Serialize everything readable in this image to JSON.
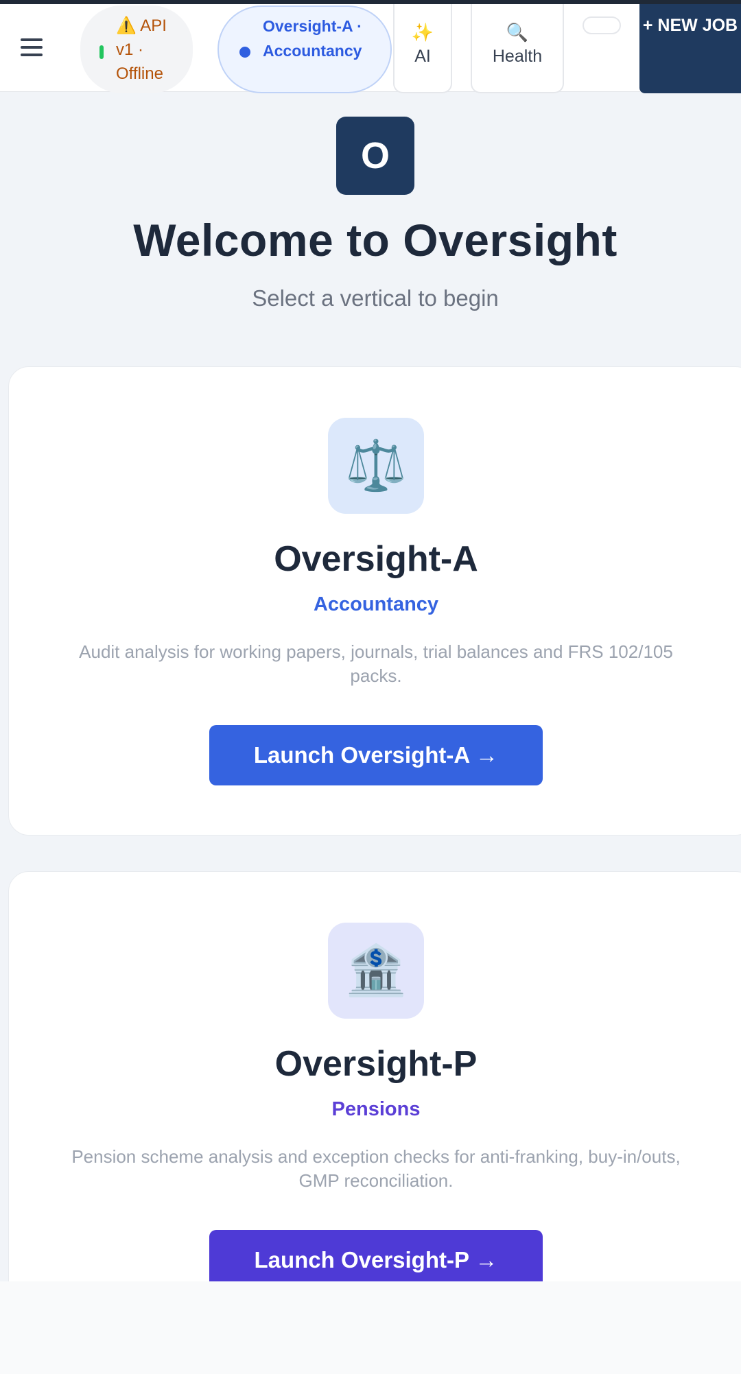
{
  "topbar": {
    "menu_icon": "hamburger-menu-icon",
    "api_status": {
      "icon": "warning-icon",
      "text": "⚠️ API v1 · Offline",
      "dot_color": "#22c55e",
      "text_color": "#b45309"
    },
    "vertical_pill": {
      "text": "Oversight-A · Accountancy",
      "dot_color": "#2f5fe0"
    },
    "ai_button": {
      "icon": "sparkles-icon",
      "glyph": "✨",
      "label": "AI"
    },
    "health_button": {
      "icon": "magnifier-icon",
      "glyph": "🔍",
      "label": "Health"
    },
    "new_job_button": {
      "label": "+ NEW JOB"
    }
  },
  "hero": {
    "logo_letter": "O",
    "title": "Welcome to Oversight",
    "subtitle": "Select a vertical to begin"
  },
  "verticals": [
    {
      "icon": "balance-scale-icon",
      "glyph": "⚖️",
      "name": "Oversight-A",
      "category": "Accountancy",
      "description": "Audit analysis for working papers, journals, trial balances and FRS 102/105 packs.",
      "button": "Launch Oversight-A →",
      "accent": "#3563e0"
    },
    {
      "icon": "bank-icon",
      "glyph": "🏦",
      "name": "Oversight-P",
      "category": "Pensions",
      "description": "Pension scheme analysis and exception checks for anti-franking, buy-in/outs, GMP reconciliation.",
      "button": "Launch Oversight-P →",
      "accent": "#4e3ad6"
    }
  ]
}
